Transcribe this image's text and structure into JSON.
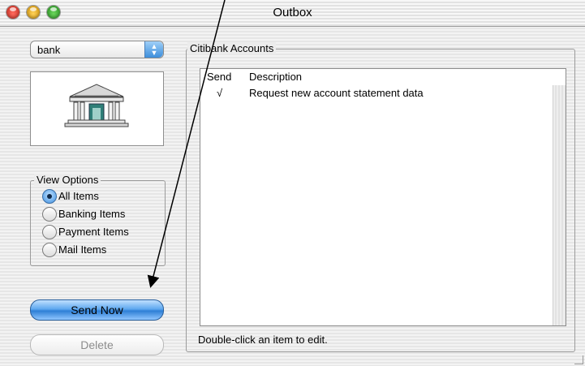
{
  "window": {
    "title": "Outbox"
  },
  "account_selector": {
    "value": "bank",
    "icon": "bank-building-icon"
  },
  "view_options": {
    "label": "View Options",
    "selected": "All Items",
    "options": [
      "All Items",
      "Banking Items",
      "Payment Items",
      "Mail Items"
    ]
  },
  "actions": {
    "send_now": "Send Now",
    "delete": "Delete"
  },
  "accounts": {
    "label": "Citibank Accounts",
    "columns": [
      "Send",
      "Description"
    ],
    "rows": [
      {
        "send": "√",
        "description": "Request new account statement data"
      }
    ],
    "hint": "Double-click an item to edit."
  },
  "colors": {
    "accent": "#3e8fe0"
  }
}
